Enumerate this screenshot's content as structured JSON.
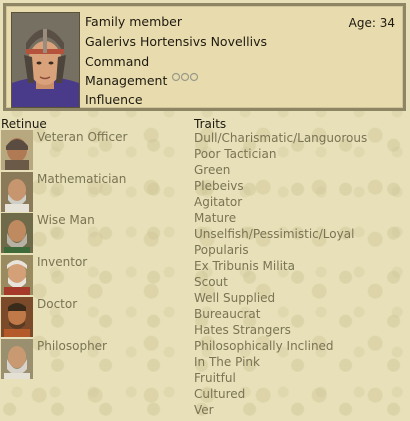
{
  "character": {
    "title": "Family member",
    "age_label": "Age: 34",
    "name": "Galerivs Hortensivs Novellivs",
    "stats": {
      "command": "Command",
      "management": "Management",
      "influence": "Influence"
    }
  },
  "retinue": {
    "heading": "Retinue",
    "items": [
      {
        "label": "Veteran Officer"
      },
      {
        "label": "Mathematician"
      },
      {
        "label": "Wise Man"
      },
      {
        "label": "Inventor"
      },
      {
        "label": "Doctor"
      },
      {
        "label": "Philosopher"
      }
    ]
  },
  "traits": {
    "heading": "Traits",
    "items": [
      "Dull/Charismatic/Languorous",
      "Poor Tactician",
      "Green",
      "Plebeivs",
      "Agitator",
      "Mature",
      "Unselfish/Pessimistic/Loyal",
      "Popularis",
      "Ex Tribunis Milita",
      "Scout",
      "Well Supplied",
      "Bureaucrat",
      "Hates Strangers",
      "Philosophically Inclined",
      "In The Pink",
      "Fruitful",
      "Cultured",
      "Ver"
    ]
  },
  "colors": {
    "panel": "#e8dcae",
    "panel_border": "#8d8563",
    "muted_text": "#7a7354",
    "text": "#1e1a10"
  }
}
